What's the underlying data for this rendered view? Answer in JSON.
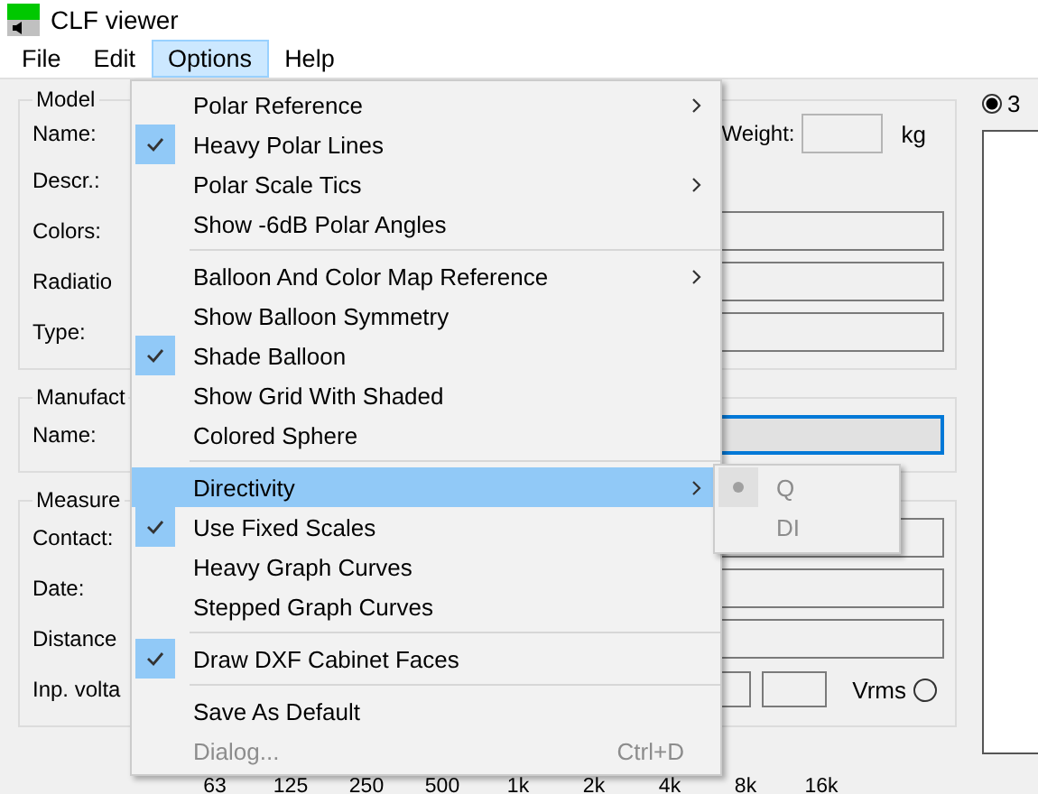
{
  "window": {
    "title": "CLF viewer"
  },
  "menubar": [
    {
      "label": "File",
      "selected": false
    },
    {
      "label": "Edit",
      "selected": false
    },
    {
      "label": "Options",
      "selected": true
    },
    {
      "label": "Help",
      "selected": false
    }
  ],
  "model": {
    "title": "Model",
    "labels": [
      "Name:",
      "Descr.:",
      "Colors:",
      "Radiatio",
      "Type:"
    ],
    "weight_label": "Weight:",
    "weight_unit": "kg"
  },
  "manufacturer": {
    "title": "Manufact",
    "labels": [
      "Name:"
    ]
  },
  "measurement": {
    "title": "Measure",
    "labels": [
      "Contact:",
      "Date:",
      "Distance",
      "Inp. volta"
    ],
    "voltage_unit": "Vrms",
    "voltage_option": {
      "selected": false
    }
  },
  "view_option": {
    "label": "3",
    "selected": true
  },
  "frequencies": [
    "63",
    "125",
    "250",
    "500",
    "1k",
    "2k",
    "4k",
    "8k",
    "16k"
  ],
  "options_menu": [
    {
      "kind": "item",
      "label": "Polar Reference",
      "checked": false,
      "submenu": true,
      "highlighted": false,
      "disabled": false
    },
    {
      "kind": "item",
      "label": "Heavy Polar Lines",
      "checked": true,
      "submenu": false,
      "highlighted": false,
      "disabled": false
    },
    {
      "kind": "item",
      "label": "Polar Scale Tics",
      "checked": false,
      "submenu": true,
      "highlighted": false,
      "disabled": false
    },
    {
      "kind": "item",
      "label": "Show -6dB Polar Angles",
      "checked": false,
      "submenu": false,
      "highlighted": false,
      "disabled": false
    },
    {
      "kind": "separator"
    },
    {
      "kind": "item",
      "label": "Balloon And Color Map Reference",
      "checked": false,
      "submenu": true,
      "highlighted": false,
      "disabled": false
    },
    {
      "kind": "item",
      "label": "Show Balloon Symmetry",
      "checked": false,
      "submenu": false,
      "highlighted": false,
      "disabled": false
    },
    {
      "kind": "item",
      "label": "Shade Balloon",
      "checked": true,
      "submenu": false,
      "highlighted": false,
      "disabled": false
    },
    {
      "kind": "item",
      "label": "Show Grid With Shaded",
      "checked": false,
      "submenu": false,
      "highlighted": false,
      "disabled": false
    },
    {
      "kind": "item",
      "label": "Colored Sphere",
      "checked": false,
      "submenu": false,
      "highlighted": false,
      "disabled": false
    },
    {
      "kind": "separator"
    },
    {
      "kind": "item",
      "label": "Directivity",
      "checked": false,
      "submenu": true,
      "highlighted": true,
      "disabled": false
    },
    {
      "kind": "item",
      "label": "Use Fixed Scales",
      "checked": true,
      "submenu": false,
      "highlighted": false,
      "disabled": false
    },
    {
      "kind": "item",
      "label": "Heavy Graph Curves",
      "checked": false,
      "submenu": false,
      "highlighted": false,
      "disabled": false
    },
    {
      "kind": "item",
      "label": "Stepped Graph Curves",
      "checked": false,
      "submenu": false,
      "highlighted": false,
      "disabled": false
    },
    {
      "kind": "separator"
    },
    {
      "kind": "item",
      "label": "Draw DXF Cabinet Faces",
      "checked": true,
      "submenu": false,
      "highlighted": false,
      "disabled": false
    },
    {
      "kind": "separator"
    },
    {
      "kind": "item",
      "label": "Save As Default",
      "checked": false,
      "submenu": false,
      "highlighted": false,
      "disabled": false
    },
    {
      "kind": "item",
      "label": "Dialog...",
      "checked": false,
      "submenu": false,
      "highlighted": false,
      "disabled": true,
      "shortcut": "Ctrl+D"
    }
  ],
  "directivity_menu": [
    {
      "label": "Q",
      "selected": true,
      "disabled": true
    },
    {
      "label": "DI",
      "selected": false,
      "disabled": true
    }
  ]
}
